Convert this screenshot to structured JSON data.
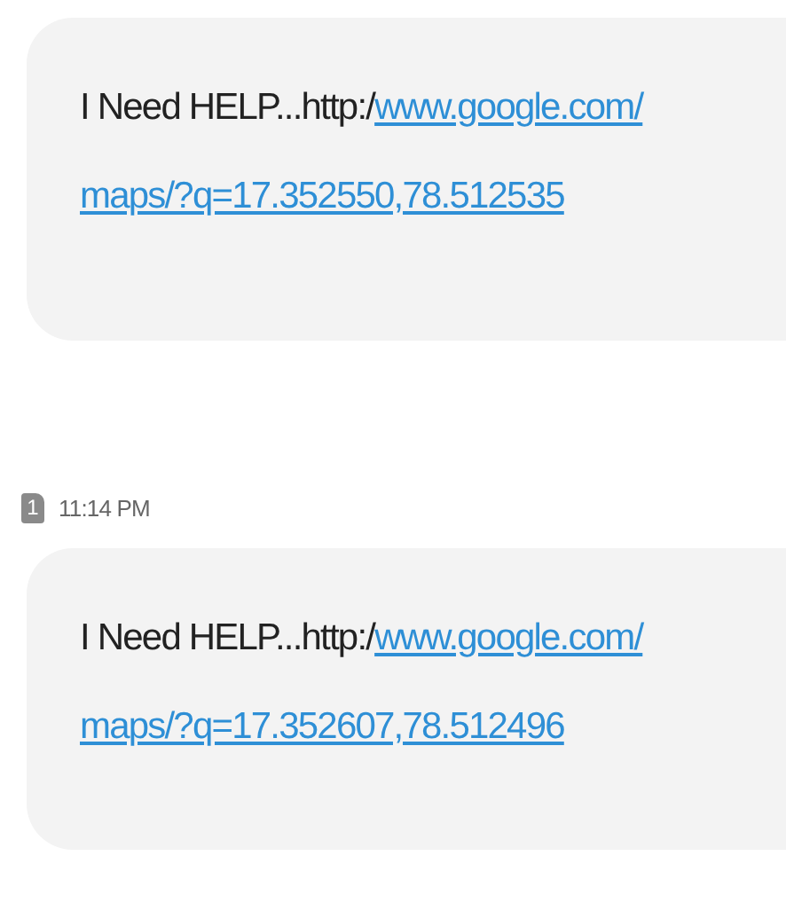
{
  "messages": [
    {
      "prefix": "I Need HELP...http:/",
      "link_lines": [
        "www.google.com/",
        "maps/?q=17.352550,78.512535"
      ]
    },
    {
      "sim": "1",
      "time": "11:14 PM",
      "prefix": "I Need HELP...http:/",
      "link_lines": [
        "www.google.com/",
        "maps/?q=17.352607,78.512496"
      ]
    }
  ]
}
